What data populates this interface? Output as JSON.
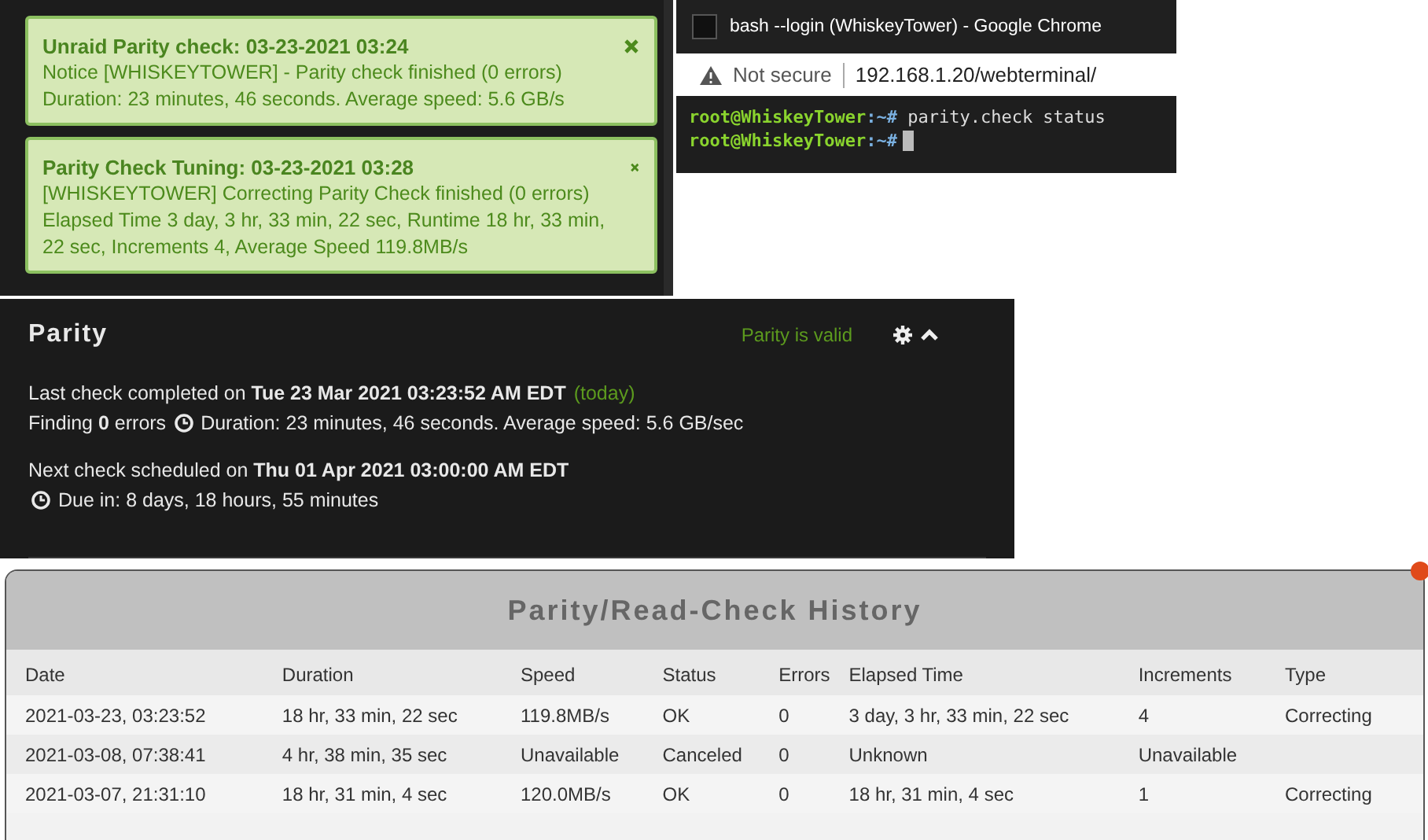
{
  "notifications": [
    {
      "title": "Unraid Parity check: 03-23-2021 03:24",
      "body": [
        "Notice [WHISKEYTOWER] - Parity check finished (0 errors)",
        "Duration: 23 minutes, 46 seconds. Average speed: 5.6 GB/s"
      ]
    },
    {
      "title": "Parity Check Tuning: 03-23-2021 03:28",
      "body": [
        "[WHISKEYTOWER] Correcting Parity Check finished (0 errors)",
        "Elapsed Time 3 day, 3 hr, 33 min, 22 sec, Runtime 18 hr, 33 min, 22 sec, Increments 4, Average Speed 119.8MB/s"
      ]
    }
  ],
  "terminal": {
    "window_title": "bash --login (WhiskeyTower) - Google Chrome",
    "security_label": "Not secure",
    "url": "192.168.1.20/webterminal/",
    "lines": [
      {
        "prompt": "root@WhiskeyTower",
        "path": ":~#",
        "command": "parity.check status"
      },
      {
        "prompt": "root@WhiskeyTower",
        "path": ":~#"
      }
    ]
  },
  "parity": {
    "title": "Parity",
    "status": "Parity is valid",
    "last_check": "Last check completed on **Tue 23 Mar 2021 03:23:52 AM EDT**",
    "last_check_note": "(today)",
    "errors": "Finding **0** errors",
    "duration": "Duration: 23 minutes, 46 seconds. Average speed: 5.6 GB/sec",
    "next_check": "Next check scheduled on **Thu 01 Apr 2021 03:00:00 AM EDT**",
    "due": "Due in: 8 days, 18 hours, 55 minutes"
  },
  "history": {
    "title": "Parity/Read-Check History",
    "columns": [
      "Date",
      "Duration",
      "Speed",
      "Status",
      "Errors",
      "Elapsed Time",
      "Increments",
      "Type"
    ],
    "rows": [
      [
        "2021-03-23, 03:23:52",
        "18 hr, 33 min, 22 sec",
        "119.8MB/s",
        "OK",
        "0",
        "3 day, 3 hr, 33 min, 22 sec",
        "4",
        "Correcting"
      ],
      [
        "2021-03-08, 07:38:41",
        "4 hr, 38 min, 35 sec",
        "Unavailable",
        "Canceled",
        "0",
        "Unknown",
        "Unavailable",
        ""
      ],
      [
        "2021-03-07, 21:31:10",
        "18 hr, 31 min, 4 sec",
        "120.0MB/s",
        "OK",
        "0",
        "18 hr, 31 min, 4 sec",
        "1",
        "Correcting"
      ]
    ]
  }
}
